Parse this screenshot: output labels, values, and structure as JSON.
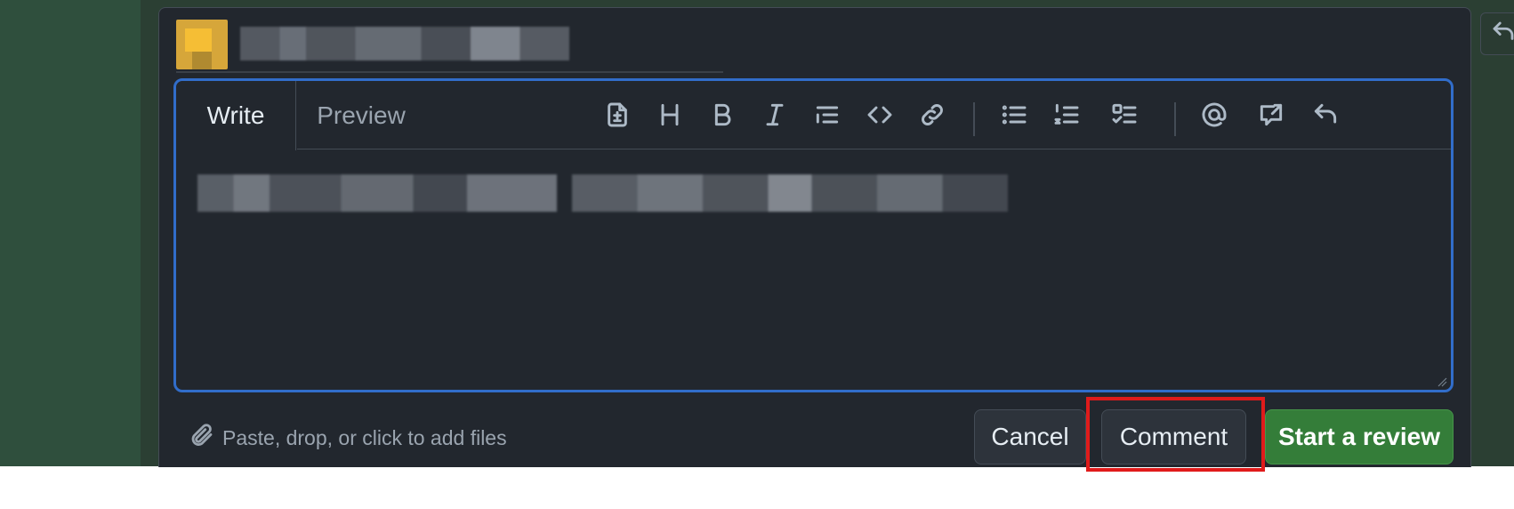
{
  "editor": {
    "tabs": {
      "write": "Write",
      "preview": "Preview"
    },
    "toolbar_icons": [
      "add-suggestion-icon",
      "heading-icon",
      "bold-icon",
      "italic-icon",
      "quote-icon",
      "code-icon",
      "link-icon",
      "bulleted-list-icon",
      "numbered-list-icon",
      "task-list-icon",
      "mention-icon",
      "reference-icon",
      "saved-replies-icon"
    ]
  },
  "footer": {
    "attach_text": "Paste, drop, or click to add files",
    "cancel_label": "Cancel",
    "comment_label": "Comment",
    "start_review_label": "Start a review"
  },
  "colors": {
    "highlight": "#e01b1b",
    "primary_button": "#347d39",
    "focus_border": "#316dca"
  }
}
